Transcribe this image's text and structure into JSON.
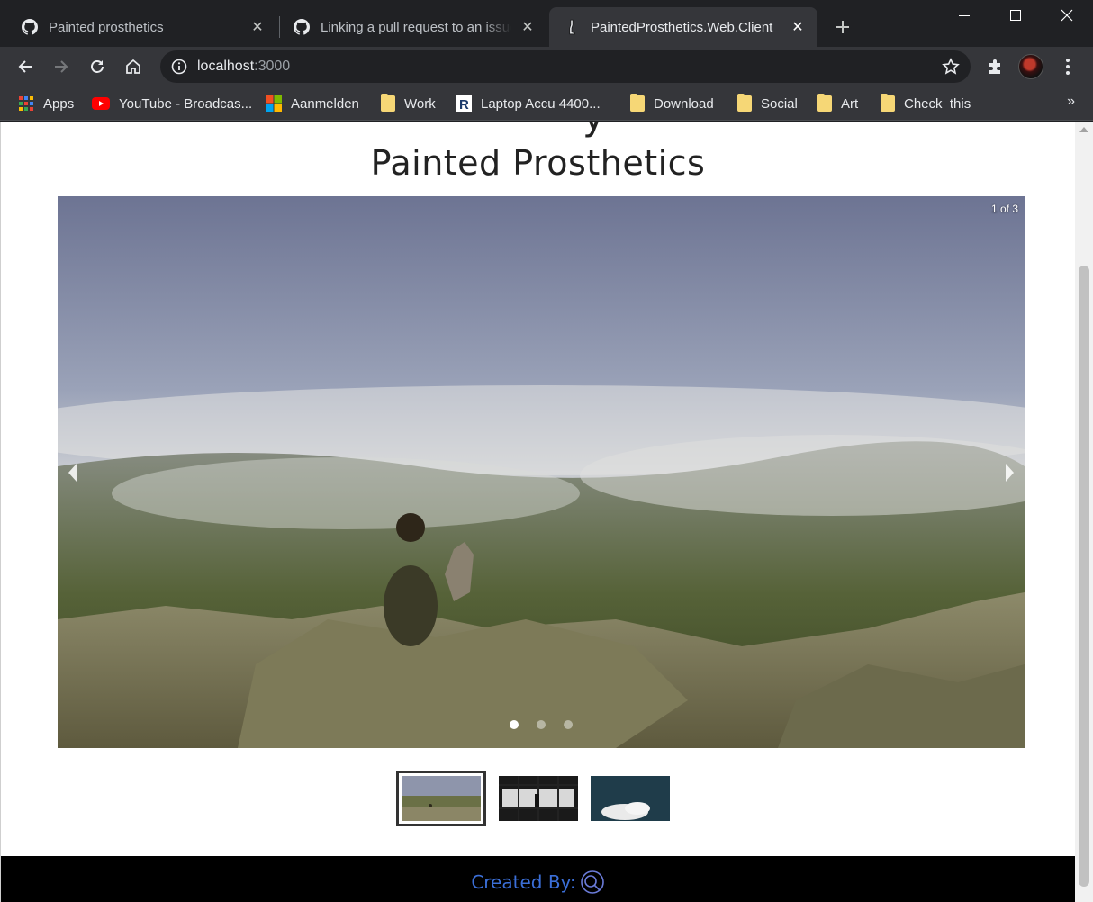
{
  "tabs": [
    {
      "title": "Painted prosthetics",
      "icon": "github-icon",
      "active": false
    },
    {
      "title": "Linking a pull request to an issue",
      "icon": "github-icon",
      "active": false
    },
    {
      "title": "PaintedProsthetics.Web.Client",
      "icon": "prosthetic-leg-icon",
      "active": true
    }
  ],
  "toolbar": {
    "url_host": "localhost",
    "url_port": ":3000"
  },
  "bookmarks": [
    {
      "label": "Apps",
      "icon": "apps-grid-icon"
    },
    {
      "label": "YouTube - Broadcas...",
      "icon": "youtube-icon"
    },
    {
      "label": "Aanmelden",
      "icon": "microsoft-icon"
    },
    {
      "label": "Work",
      "icon": "folder-icon"
    },
    {
      "label": "Laptop Accu 4400...",
      "icon": "r-logo-icon"
    },
    {
      "label": "Download",
      "icon": "folder-icon"
    },
    {
      "label": "Social",
      "icon": "folder-icon"
    },
    {
      "label": "Art",
      "icon": "folder-icon"
    },
    {
      "label": "Check  this",
      "icon": "folder-icon"
    }
  ],
  "bookmarks_more": "»",
  "page": {
    "heading_cut": "y",
    "title": "Painted Prosthetics",
    "carousel": {
      "counter": "1 of 3",
      "current": 1,
      "total": 3
    },
    "footer": {
      "created_by": "Created By:"
    }
  },
  "colors": {
    "chrome_dark": "#202124",
    "chrome_toolbar": "#35363a",
    "footer_bg": "#000000",
    "footer_link": "#3b6fd8"
  }
}
